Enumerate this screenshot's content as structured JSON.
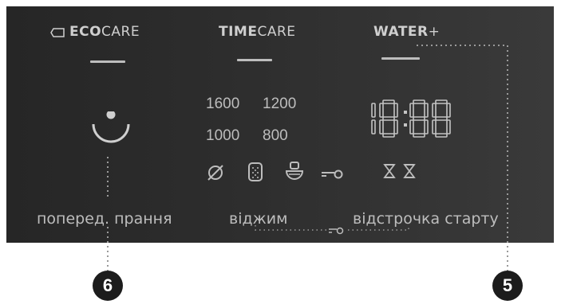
{
  "modes": {
    "eco": {
      "bold": "ECO",
      "rest": "CARE",
      "icon": "tag-icon"
    },
    "time": {
      "bold": "TIME",
      "rest": "CARE"
    },
    "water": {
      "bold": "WATER",
      "rest": "+"
    }
  },
  "spin_speeds": [
    "1600",
    "1200",
    "1000",
    "800"
  ],
  "clock_display": "18:88",
  "status_icons": [
    "no-spin-icon",
    "drum-icon",
    "rinse-hold-icon",
    "key-lock-icon"
  ],
  "delay_icons": [
    "hourglass-icon",
    "hourglass-icon"
  ],
  "labels": {
    "prewash": "поперед. прання",
    "spin": "віджим",
    "delay_start": "відстрочка старту"
  },
  "callouts": {
    "left": "6",
    "right": "5"
  },
  "colors": {
    "panel": "#2b2b2b",
    "text": "#bdbdbd",
    "badge": "#1c1c1c"
  }
}
